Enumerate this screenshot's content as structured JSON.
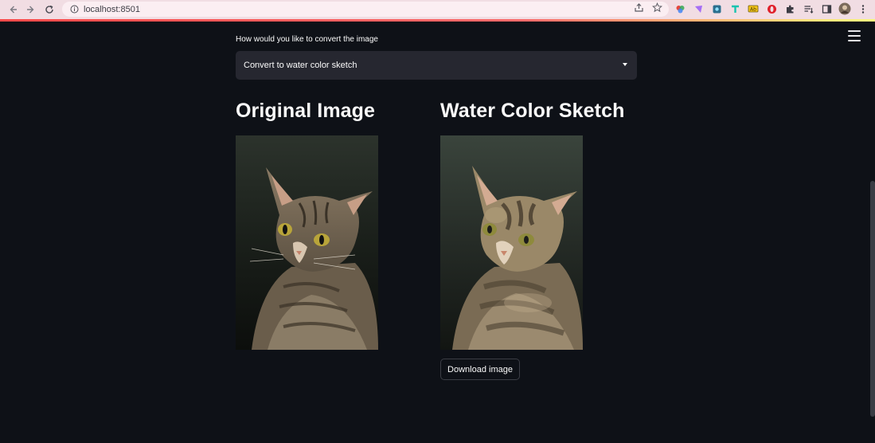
{
  "browser": {
    "url": "localhost:8501"
  },
  "app": {
    "select_label": "How would you like to convert the image",
    "select_value": "Convert to water color sketch",
    "original_title": "Original Image",
    "result_title": "Water Color Sketch",
    "download_label": "Download image"
  },
  "icons": {
    "back": "arrow-left",
    "forward": "arrow-right",
    "reload": "reload",
    "info": "info-circle",
    "share": "share",
    "bookmark": "star",
    "menu": "hamburger"
  },
  "colors": {
    "background": "#0e1117",
    "select_bg": "#262730",
    "text": "#fafafa",
    "accent": "#ff4b4b"
  }
}
